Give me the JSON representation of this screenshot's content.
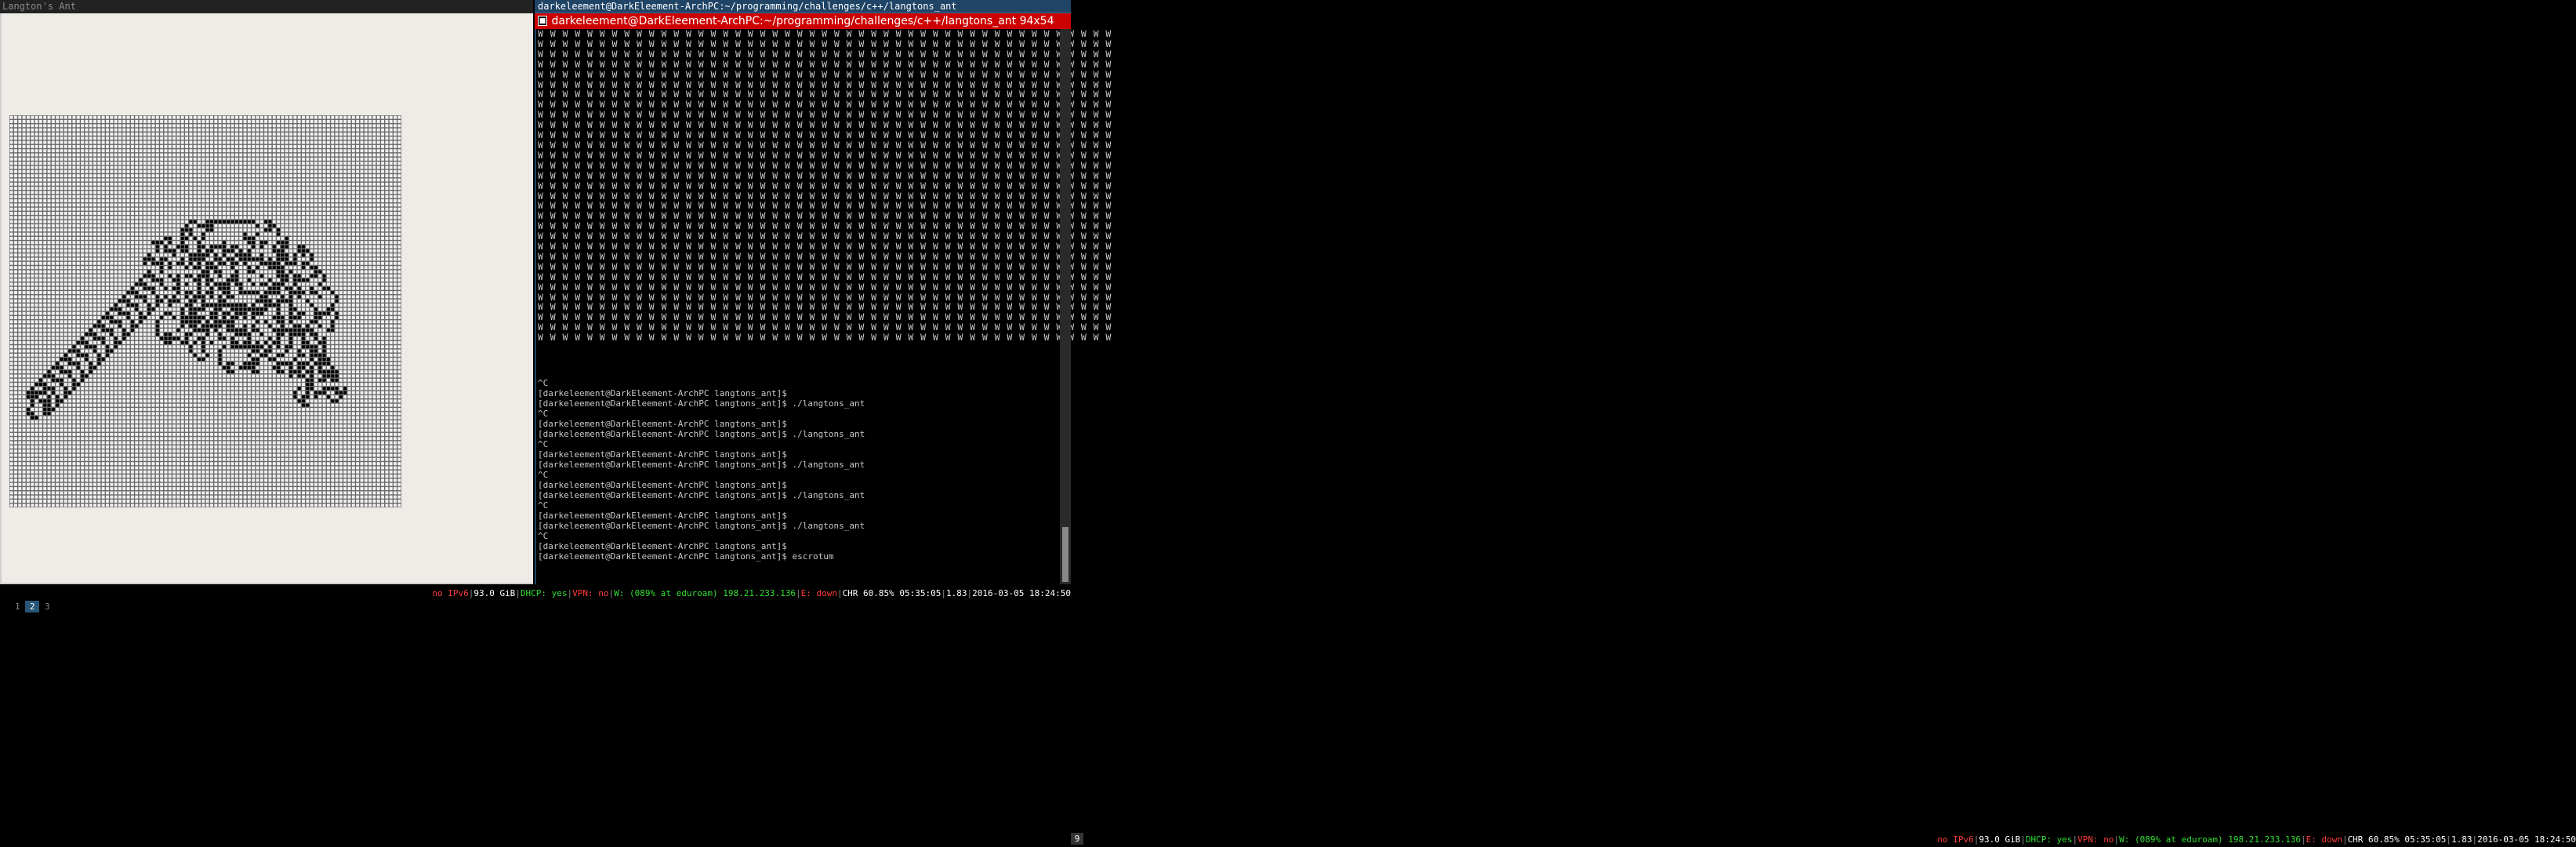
{
  "left_window": {
    "title": "Langton's Ant",
    "grid_size": 94
  },
  "terminal": {
    "title": "darkeleement@DarkEleement-ArchPC:~/programming/challenges/c++/langtons_ant",
    "header_title": "darkeleement@DarkEleement-ArchPC:~/programming/challenges/c++/langtons_ant 94x54",
    "w_char": "W",
    "w_columns": 47,
    "w_rows": 31,
    "lines": [
      "^C",
      "[darkeleement@DarkEleement-ArchPC langtons_ant]$",
      "[darkeleement@DarkEleement-ArchPC langtons_ant]$ ./langtons_ant",
      "^C",
      "[darkeleement@DarkEleement-ArchPC langtons_ant]$",
      "[darkeleement@DarkEleement-ArchPC langtons_ant]$ ./langtons_ant",
      "^C",
      "[darkeleement@DarkEleement-ArchPC langtons_ant]$",
      "[darkeleement@DarkEleement-ArchPC langtons_ant]$ ./langtons_ant",
      "^C",
      "[darkeleement@DarkEleement-ArchPC langtons_ant]$",
      "[darkeleement@DarkEleement-ArchPC langtons_ant]$ ./langtons_ant",
      "^C",
      "[darkeleement@DarkEleement-ArchPC langtons_ant]$",
      "[darkeleement@DarkEleement-ArchPC langtons_ant]$ ./langtons_ant",
      "^C",
      "[darkeleement@DarkEleement-ArchPC langtons_ant]$",
      "[darkeleement@DarkEleement-ArchPC langtons_ant]$ escrotum"
    ]
  },
  "workspaces": [
    "1",
    "2",
    "3"
  ],
  "active_workspace": "2",
  "workspace_second_screen": "9",
  "status": {
    "ipv6": "no IPv6",
    "disk": "93.0 GiB",
    "dhcp": "DHCP: yes",
    "vpn": "VPN: no",
    "wifi": "W: (089% at eduroam) 198.21.233.136",
    "eth": "E: down",
    "battery": "CHR 60.85% 05:35:05",
    "load": "1.83",
    "datetime": "2016-03-05 18:24:50"
  },
  "colors": {
    "bad": "#ff3b3b",
    "good": "#33dd33",
    "terminal_title_bar": "#cc0000",
    "window_title_focused": "#1f4466",
    "workspace_active": "#285577"
  }
}
